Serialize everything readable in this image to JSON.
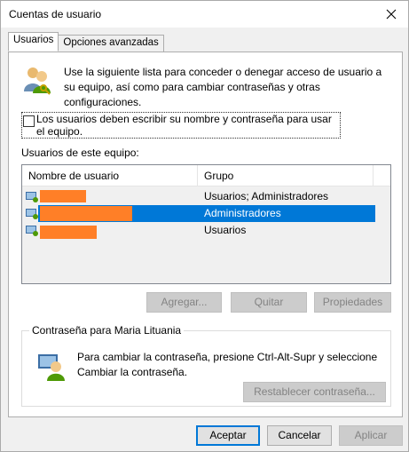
{
  "window": {
    "title": "Cuentas de usuario",
    "close_glyph": "✕"
  },
  "tabs": [
    {
      "label": "Usuarios",
      "active": true
    },
    {
      "label": "Opciones avanzadas",
      "active": false
    }
  ],
  "intro": {
    "icon": "users-icon",
    "text": "Use la siguiente lista para conceder o denegar acceso de usuario a su equipo, así como para cambiar contraseñas y otras configuraciones."
  },
  "require_login": {
    "label": "Los usuarios deben escribir su nombre y contraseña para usar el equipo.",
    "checked": false
  },
  "users_section": {
    "label": "Usuarios de este equipo:",
    "columns": [
      "Nombre de usuario",
      "Grupo"
    ],
    "rows": [
      {
        "name_redacted": true,
        "group": "Usuarios; Administradores",
        "selected": false
      },
      {
        "name_redacted": true,
        "group": "Administradores",
        "selected": true
      },
      {
        "name_redacted": true,
        "group": "Usuarios",
        "selected": false
      }
    ]
  },
  "user_buttons": {
    "add": "Agregar...",
    "remove": "Quitar",
    "properties": "Propiedades"
  },
  "password_group": {
    "title": "Contraseña para Maria Lituania",
    "icon": "user-key-icon",
    "text": "Para cambiar la contraseña, presione Ctrl-Alt-Supr y seleccione Cambiar la contraseña.",
    "reset_button": "Restablecer contraseña..."
  },
  "dialog_buttons": {
    "ok": "Aceptar",
    "cancel": "Cancelar",
    "apply": "Aplicar"
  },
  "colors": {
    "selection": "#0078d7",
    "redaction": "#ff7f27"
  }
}
